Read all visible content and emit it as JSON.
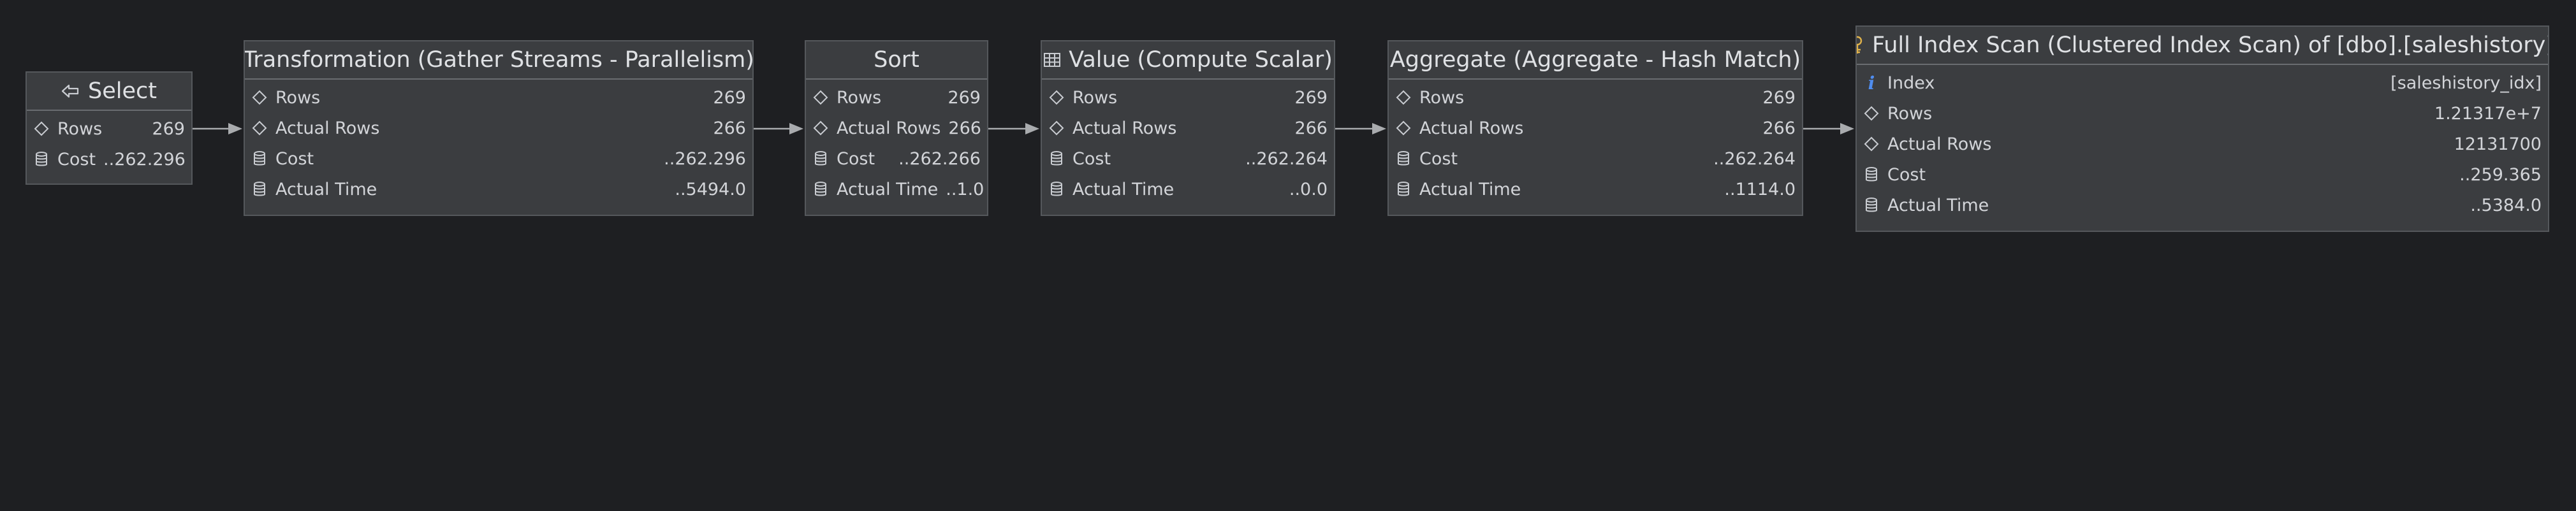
{
  "plan": {
    "nodes": [
      {
        "title": "Select",
        "icon": "arrow-left-select-icon",
        "rows": [
          {
            "label": "Rows",
            "value": "269",
            "icon": "diamond-icon"
          },
          {
            "label": "Cost",
            "value": "..262.296",
            "icon": "database-icon"
          }
        ]
      },
      {
        "title": "Transformation (Gather Streams - Parallelism)",
        "icon": "",
        "rows": [
          {
            "label": "Rows",
            "value": "269",
            "icon": "diamond-icon"
          },
          {
            "label": "Actual Rows",
            "value": "266",
            "icon": "diamond-icon"
          },
          {
            "label": "Cost",
            "value": "..262.296",
            "icon": "database-icon"
          },
          {
            "label": "Actual Time",
            "value": "..5494.0",
            "icon": "database-icon"
          }
        ]
      },
      {
        "title": "Sort",
        "icon": "",
        "rows": [
          {
            "label": "Rows",
            "value": "269",
            "icon": "diamond-icon"
          },
          {
            "label": "Actual Rows",
            "value": "266",
            "icon": "diamond-icon"
          },
          {
            "label": "Cost",
            "value": "..262.266",
            "icon": "database-icon"
          },
          {
            "label": "Actual Time",
            "value": "..1.0",
            "icon": "database-icon"
          }
        ]
      },
      {
        "title": "Value (Compute Scalar)",
        "icon": "table-icon",
        "rows": [
          {
            "label": "Rows",
            "value": "269",
            "icon": "diamond-icon"
          },
          {
            "label": "Actual Rows",
            "value": "266",
            "icon": "diamond-icon"
          },
          {
            "label": "Cost",
            "value": "..262.264",
            "icon": "database-icon"
          },
          {
            "label": "Actual Time",
            "value": "..0.0",
            "icon": "database-icon"
          }
        ]
      },
      {
        "title": "Aggregate (Aggregate - Hash Match)",
        "icon": "",
        "rows": [
          {
            "label": "Rows",
            "value": "269",
            "icon": "diamond-icon"
          },
          {
            "label": "Actual Rows",
            "value": "266",
            "icon": "diamond-icon"
          },
          {
            "label": "Cost",
            "value": "..262.264",
            "icon": "database-icon"
          },
          {
            "label": "Actual Time",
            "value": "..1114.0",
            "icon": "database-icon"
          }
        ]
      },
      {
        "title": "Full Index Scan (Clustered Index Scan) of [dbo].[saleshistory]",
        "icon": "key-icon",
        "rows": [
          {
            "label": "Index",
            "value": "[saleshistory_idx]",
            "icon": "info-icon"
          },
          {
            "label": "Rows",
            "value": "1.21317e+7",
            "icon": "diamond-icon"
          },
          {
            "label": "Actual Rows",
            "value": "12131700",
            "icon": "diamond-icon"
          },
          {
            "label": "Cost",
            "value": "..259.365",
            "icon": "database-icon"
          },
          {
            "label": "Actual Time",
            "value": "..5384.0",
            "icon": "database-icon"
          }
        ]
      }
    ]
  },
  "colors": {
    "background": "#1e1f22",
    "node_fill": "#3b3d40",
    "node_border": "#55585c",
    "arrow": "#a9abae",
    "key_icon": "#e0b24a",
    "info_icon": "#4f8df0"
  }
}
